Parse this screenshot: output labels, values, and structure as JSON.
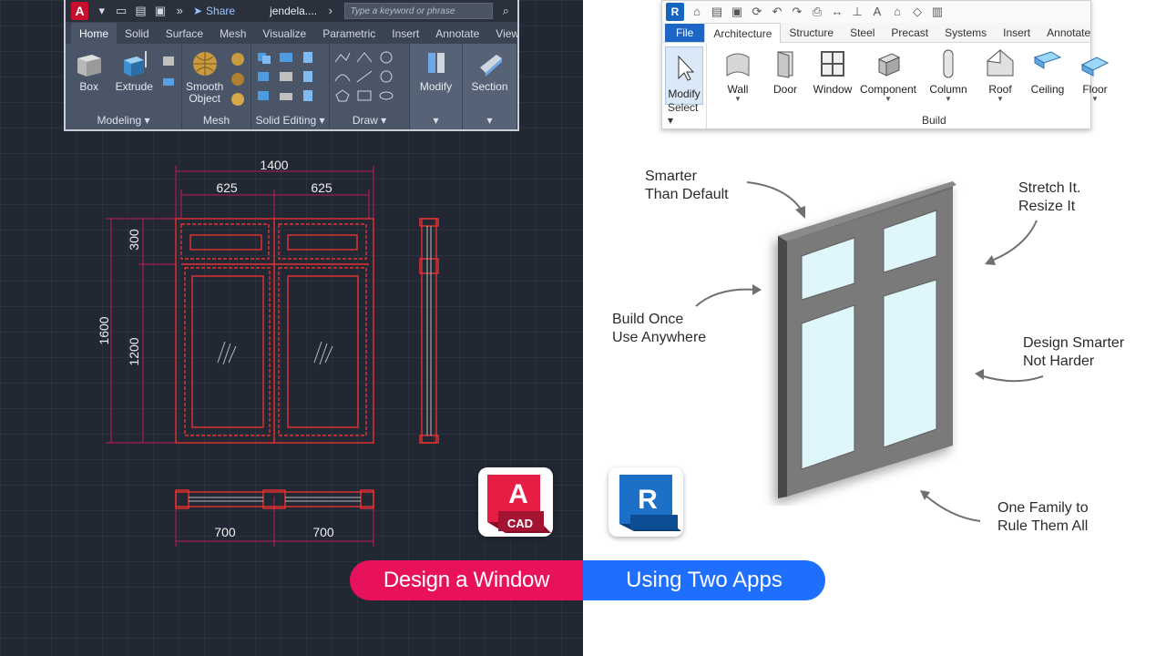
{
  "autocad": {
    "logo_letter": "A",
    "file_name": "jendela....",
    "share_label": "Share",
    "search_placeholder": "Type a keyword or phrase",
    "tabs": [
      "Home",
      "Solid",
      "Surface",
      "Mesh",
      "Visualize",
      "Parametric",
      "Insert",
      "Annotate",
      "View"
    ],
    "active_tab": "Home",
    "tools": {
      "box": "Box",
      "extrude": "Extrude",
      "smooth_object_1": "Smooth",
      "smooth_object_2": "Object",
      "modify": "Modify",
      "section": "Section"
    },
    "panels": {
      "modeling": "Modeling ▾",
      "mesh": "Mesh",
      "solid_editing": "Solid Editing ▾",
      "draw": "Draw ▾"
    }
  },
  "drawing": {
    "dims": {
      "overall_width": "1400",
      "pane_left": "625",
      "pane_right": "625",
      "top_height": "300",
      "bottom_height": "1200",
      "overall_height": "1600",
      "bottom_left": "700",
      "bottom_right": "700"
    },
    "colors": {
      "frame": "#e8322f",
      "dim": "#c2185b",
      "background": "#212733"
    }
  },
  "logos": {
    "autocad_letter": "A",
    "autocad_label": "CAD",
    "revit_letter": "R"
  },
  "revit": {
    "logo_letter": "R",
    "tabs": [
      "File",
      "Architecture",
      "Structure",
      "Steel",
      "Precast",
      "Systems",
      "Insert",
      "Annotate"
    ],
    "active_tab": "Architecture",
    "tools": [
      "Modify",
      "Wall",
      "Door",
      "Window",
      "Component",
      "Column",
      "Roof",
      "Ceiling",
      "Floor"
    ],
    "select_label": "Select ▾",
    "build_label": "Build"
  },
  "callouts": {
    "smarter_1": "Smarter",
    "smarter_2": "Than Default",
    "stretch_1": "Stretch It.",
    "stretch_2": "Resize It",
    "build_1": "Build Once",
    "build_2": "Use Anywhere",
    "design_1": "Design Smarter",
    "design_2": "Not Harder",
    "family_1": "One Family to",
    "family_2": "Rule Them All"
  },
  "banner": {
    "left": "Design a Window",
    "right": "Using Two Apps",
    "left_color": "#e8125c",
    "right_color": "#1f6fff"
  }
}
